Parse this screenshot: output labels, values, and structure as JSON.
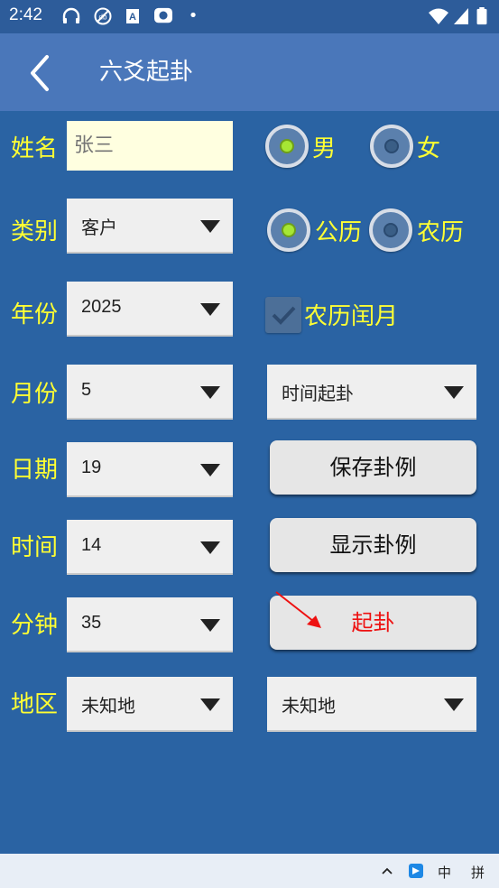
{
  "status": {
    "time": "2:42"
  },
  "app": {
    "title": "六爻起卦"
  },
  "form": {
    "name": {
      "label": "姓名",
      "placeholder": "张三"
    },
    "gender": {
      "male": "男",
      "female": "女",
      "selected": "男"
    },
    "category": {
      "label": "类别",
      "value": "客户"
    },
    "calendar": {
      "solar": "公历",
      "lunar": "农历",
      "selected": "公历"
    },
    "year": {
      "label": "年份",
      "value": "2025"
    },
    "leap_month": {
      "label": "农历闰月",
      "checked": true
    },
    "month": {
      "label": "月份",
      "value": "5"
    },
    "method": {
      "value": "时间起卦"
    },
    "day": {
      "label": "日期",
      "value": "19"
    },
    "hour": {
      "label": "时间",
      "value": "14"
    },
    "minute": {
      "label": "分钟",
      "value": "35"
    },
    "region": {
      "label": "地区",
      "value": "未知地",
      "sub_value": "未知地"
    }
  },
  "buttons": {
    "save": "保存卦例",
    "show": "显示卦例",
    "start": "起卦"
  },
  "navbar": {
    "ime_mode": "中",
    "ime_layout": "拼"
  },
  "colors": {
    "background": "#2a63a3",
    "appbar": "#4a77ba",
    "label": "#ffff33",
    "radio_on": "#a6e634",
    "start_text": "#ee1111"
  }
}
